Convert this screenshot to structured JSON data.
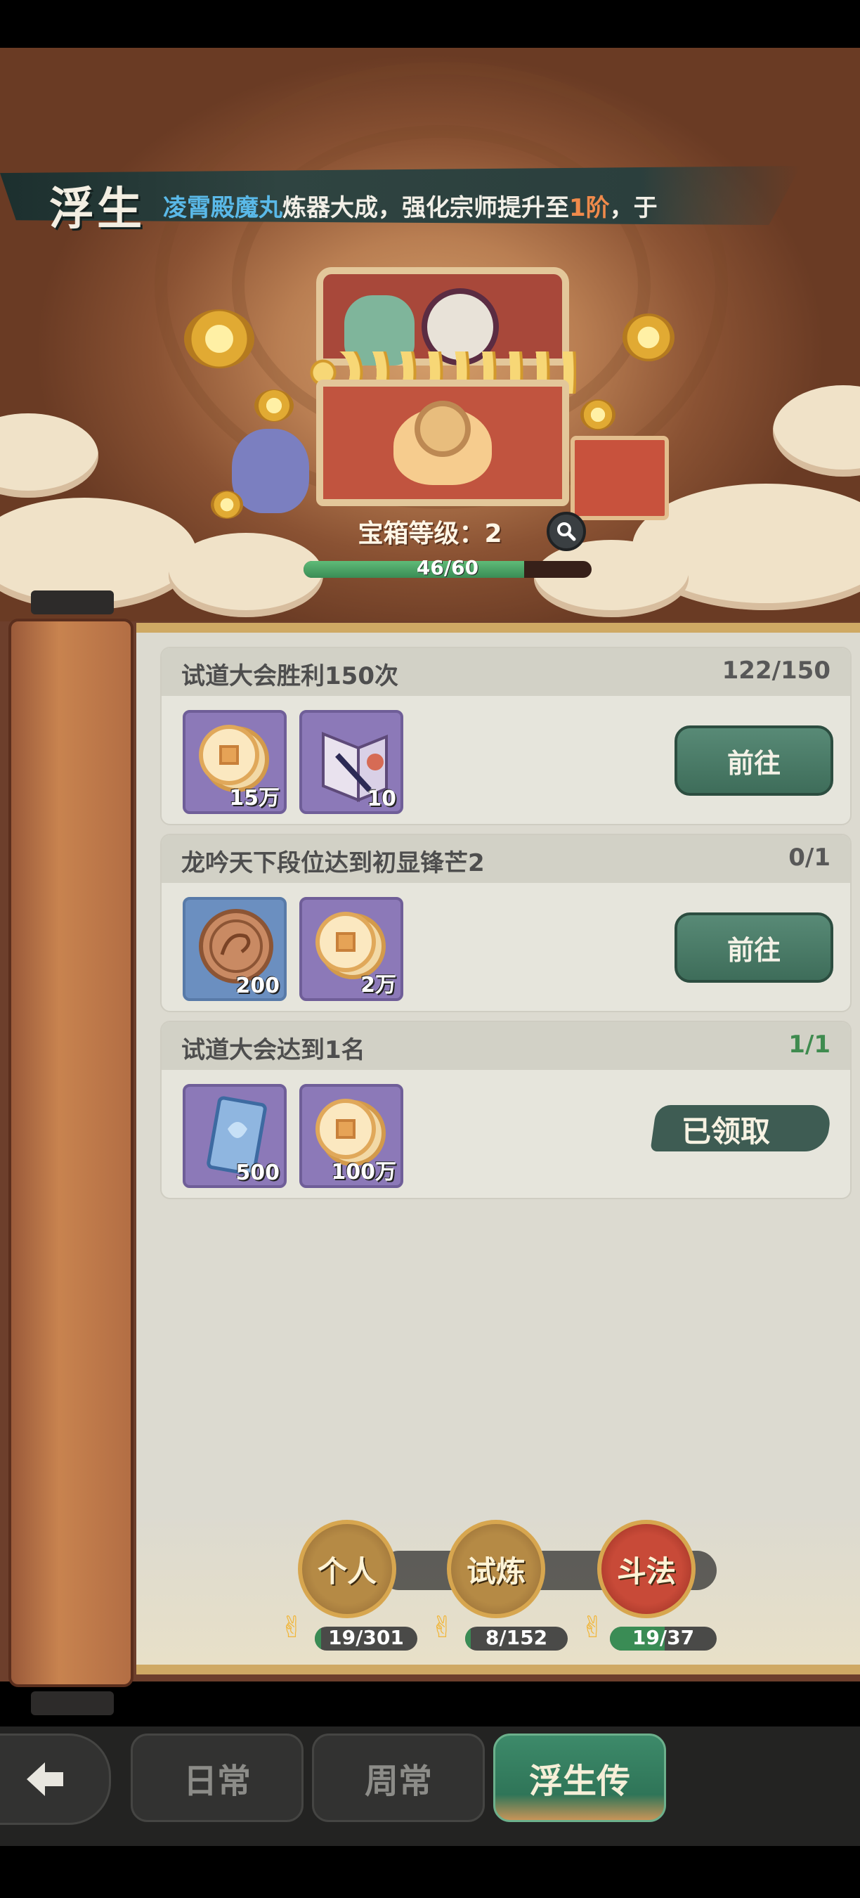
{
  "header": {
    "title": "浮生",
    "marquee": {
      "prefix_highlight": "凌霄殿魔丸",
      "middle": "炼器大成，强化宗师提升至",
      "value_highlight": "1阶",
      "suffix": "，于"
    }
  },
  "chest": {
    "level_label": "宝箱等级：2",
    "progress_text": "46/60",
    "progress_current": 46,
    "progress_max": 60
  },
  "tasks": [
    {
      "title": "试道大会胜利150次",
      "progress": "122/150",
      "rewards": [
        {
          "icon": "copper-coin-icon",
          "count": "15万"
        },
        {
          "icon": "book-icon",
          "count": "10"
        }
      ],
      "action": "前往"
    },
    {
      "title": "龙吟天下段位达到初显锋芒2",
      "progress": "0/1",
      "rewards": [
        {
          "icon": "dragon-token-icon",
          "count": "200"
        },
        {
          "icon": "copper-coin-icon",
          "count": "2万"
        }
      ],
      "action": "前往"
    },
    {
      "title": "试道大会达到1名",
      "progress": "1/1",
      "rewards": [
        {
          "icon": "blue-card-icon",
          "count": "500"
        },
        {
          "icon": "copper-coin-icon",
          "count": "100万"
        }
      ],
      "status": "已领取"
    }
  ],
  "categories": [
    {
      "label": "个人",
      "progress_text": "19/301",
      "value": 19,
      "max": 301
    },
    {
      "label": "试炼",
      "progress_text": "8/152",
      "value": 8,
      "max": 152
    },
    {
      "label": "斗法",
      "progress_text": "19/37",
      "value": 19,
      "max": 37
    }
  ],
  "nav": {
    "back": "back-arrow-icon",
    "tabs": [
      "日常",
      "周常",
      "浮生传"
    ],
    "active_tab": "浮生传"
  },
  "colors": {
    "accent_green": "#3a8c55",
    "highlight_blue": "#5ab9e8",
    "highlight_orange": "#f08a4b",
    "done_green": "#3f8b4f"
  }
}
